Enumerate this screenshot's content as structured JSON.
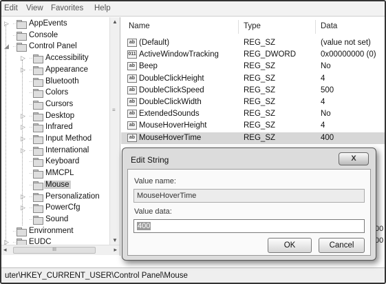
{
  "menu": [
    "Edit",
    "View",
    "Favorites",
    "Help"
  ],
  "tree": {
    "items": [
      {
        "label": "AppEvents",
        "expander": "▷"
      },
      {
        "label": "Console",
        "expander": ""
      },
      {
        "label": "Control Panel",
        "expander": "◢"
      },
      {
        "label": "Accessibility",
        "expander": "▷"
      },
      {
        "label": "Appearance",
        "expander": "▷"
      },
      {
        "label": "Bluetooth",
        "expander": ""
      },
      {
        "label": "Colors",
        "expander": ""
      },
      {
        "label": "Cursors",
        "expander": ""
      },
      {
        "label": "Desktop",
        "expander": "▷"
      },
      {
        "label": "Infrared",
        "expander": "▷"
      },
      {
        "label": "Input Method",
        "expander": "▷"
      },
      {
        "label": "International",
        "expander": "▷"
      },
      {
        "label": "Keyboard",
        "expander": ""
      },
      {
        "label": "MMCPL",
        "expander": ""
      },
      {
        "label": "Mouse",
        "expander": ""
      },
      {
        "label": "Personalization",
        "expander": "▷"
      },
      {
        "label": "PowerCfg",
        "expander": "▷"
      },
      {
        "label": "Sound",
        "expander": ""
      },
      {
        "label": "Environment",
        "expander": ""
      },
      {
        "label": "EUDC",
        "expander": "▷"
      }
    ],
    "selected": "Mouse",
    "scroll_grip": "≡",
    "hscroll_grip": "III"
  },
  "list": {
    "columns": [
      "Name",
      "Type",
      "Data"
    ],
    "rows": [
      {
        "icon": "ab",
        "name": "(Default)",
        "type": "REG_SZ",
        "data": "(value not set)"
      },
      {
        "icon": "011",
        "name": "ActiveWindowTracking",
        "type": "REG_DWORD",
        "data": "0x00000000 (0)"
      },
      {
        "icon": "ab",
        "name": "Beep",
        "type": "REG_SZ",
        "data": "No"
      },
      {
        "icon": "ab",
        "name": "DoubleClickHeight",
        "type": "REG_SZ",
        "data": "4"
      },
      {
        "icon": "ab",
        "name": "DoubleClickSpeed",
        "type": "REG_SZ",
        "data": "500"
      },
      {
        "icon": "ab",
        "name": "DoubleClickWidth",
        "type": "REG_SZ",
        "data": "4"
      },
      {
        "icon": "ab",
        "name": "ExtendedSounds",
        "type": "REG_SZ",
        "data": "No"
      },
      {
        "icon": "ab",
        "name": "MouseHoverHeight",
        "type": "REG_SZ",
        "data": "4"
      },
      {
        "icon": "ab",
        "name": "MouseHoverTime",
        "type": "REG_SZ",
        "data": "400"
      }
    ],
    "selected": "MouseHoverTime",
    "peek": [
      "00",
      "00"
    ]
  },
  "status": "uter\\HKEY_CURRENT_USER\\Control Panel\\Mouse",
  "dialog": {
    "title": "Edit String",
    "close": "X",
    "value_name_label": "Value name:",
    "value_name": "MouseHoverTime",
    "value_data_label": "Value data:",
    "value_data": "400",
    "ok": "OK",
    "cancel": "Cancel"
  }
}
